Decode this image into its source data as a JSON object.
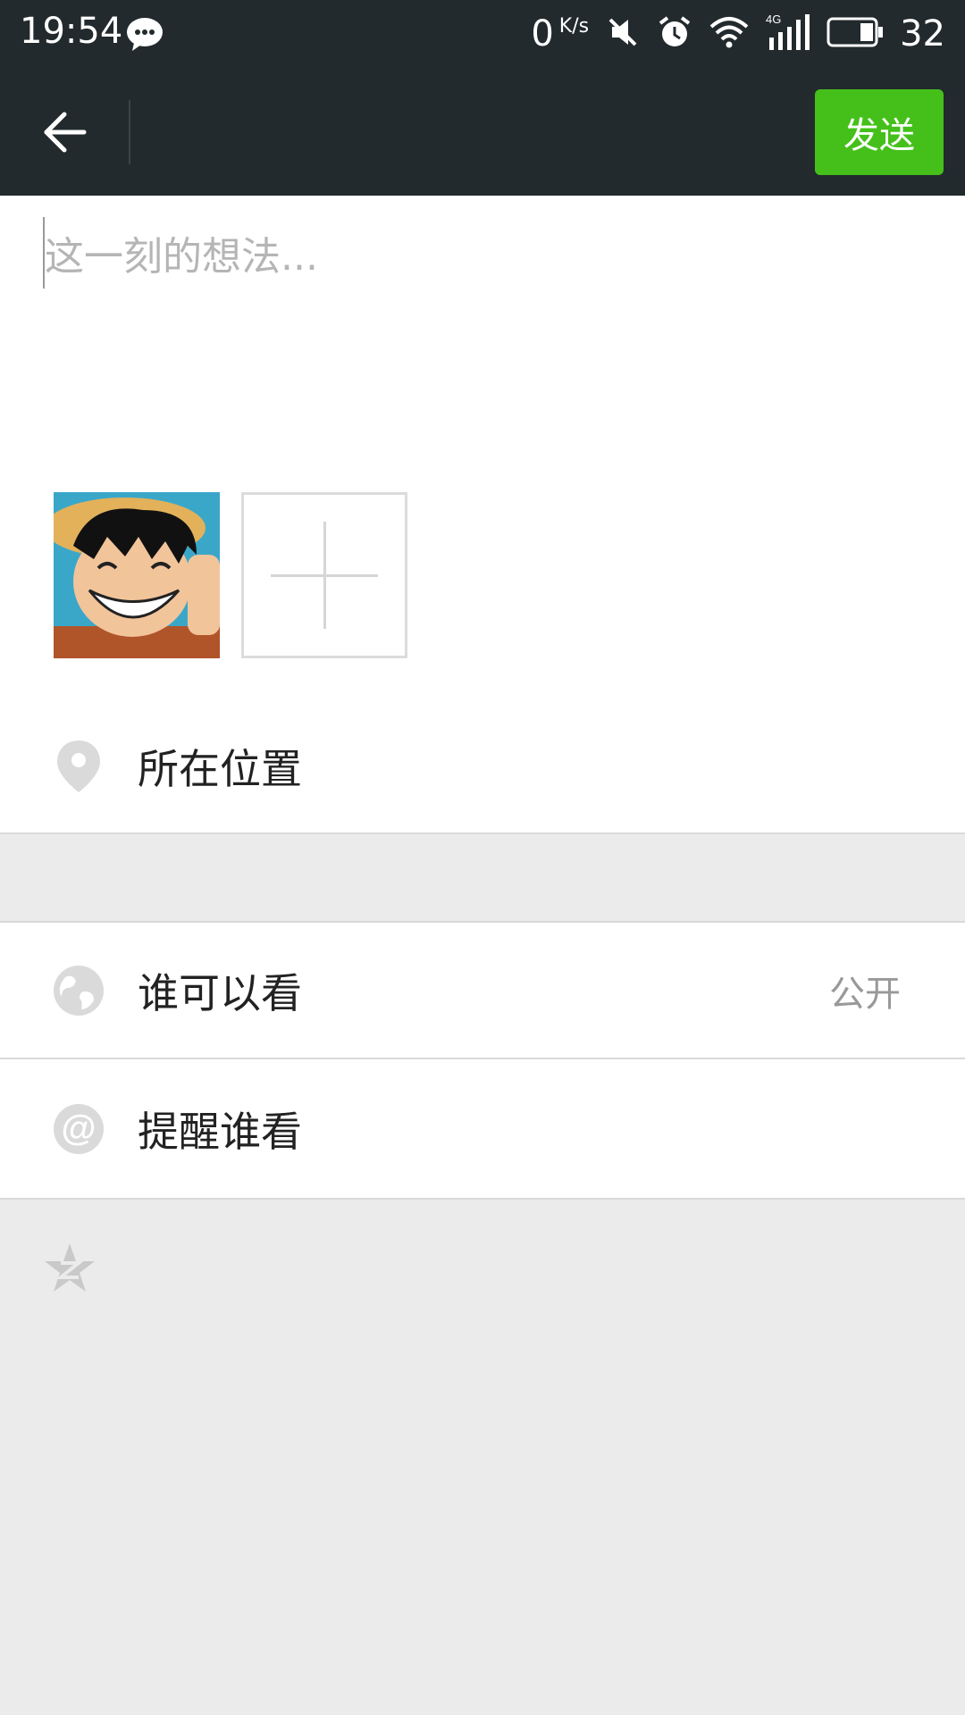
{
  "status_bar": {
    "time": "19:54",
    "net_speed_value": "0",
    "net_speed_unit": "K/s",
    "battery_percent": "32",
    "icons": [
      "wechat-icon",
      "mute-icon",
      "alarm-icon",
      "wifi-icon",
      "signal-4g-icon",
      "battery-icon"
    ]
  },
  "app_bar": {
    "send_label": "发送"
  },
  "compose": {
    "placeholder": "这一刻的想法..."
  },
  "rows": {
    "location_label": "所在位置",
    "visibility_label": "谁可以看",
    "visibility_value": "公开",
    "remind_label": "提醒谁看"
  },
  "colors": {
    "bar_bg": "#222a2d",
    "accent_green": "#45c01a",
    "page_bg": "#ebebeb"
  }
}
